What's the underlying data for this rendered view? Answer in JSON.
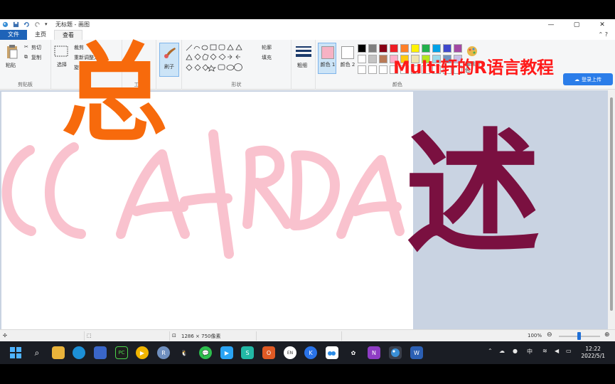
{
  "window": {
    "title": "无标题 - 画图",
    "controls": {
      "minimize": "—",
      "maximize": "▢",
      "close": "✕"
    }
  },
  "tabs": [
    {
      "label": "文件"
    },
    {
      "label": "主页"
    },
    {
      "label": "查看"
    }
  ],
  "ribbon": {
    "clipboard": {
      "paste": "粘贴",
      "cut": "剪切",
      "copy": "复制",
      "group_label": "剪贴板"
    },
    "image": {
      "select": "选择",
      "crop": "裁剪",
      "resize": "重新调整大小",
      "rotate": "旋转"
    },
    "tools": {
      "group_label": "工具"
    },
    "brush": {
      "label": "刷子"
    },
    "shapes": {
      "outline": "轮廓",
      "fill": "填充",
      "group_label": "形状"
    },
    "size": {
      "label": "粗细"
    },
    "color1": {
      "label": "颜色 1",
      "value": "#f7b2c4"
    },
    "color2": {
      "label": "颜色 2",
      "value": "#ffffff"
    },
    "colors": {
      "group_label": "颜色",
      "edit": "编辑颜色"
    },
    "palette": [
      "#000000",
      "#7f7f7f",
      "#880015",
      "#ed1c24",
      "#ff7f27",
      "#fff200",
      "#22b14c",
      "#00a2e8",
      "#3f48cc",
      "#a349a4",
      "#ffffff",
      "#c3c3c3",
      "#b97a57",
      "#ffaec9",
      "#ffc90e",
      "#efe4b0",
      "#b5e61d",
      "#99d9ea",
      "#7092be",
      "#c8bfe7",
      "#ffffff",
      "#ffffff",
      "#ffffff",
      "#ffffff",
      "#ffffff",
      "#ffffff",
      "#ffffff",
      "#ffffff",
      "#ffffff",
      "#ffffff"
    ],
    "sign_in": "登录上传"
  },
  "status": {
    "canvas_size": "1286 × 750像素",
    "zoom": "100%"
  },
  "taskbar": {
    "ime": "中",
    "lang": "EN",
    "time": "12:22",
    "date": "2022/5/1"
  },
  "overlay": {
    "channel_title": "Multi轩的R语言教程",
    "word_left": "总",
    "word_right": "述",
    "handwriting": "CCAtRDA",
    "handwriting_color": "#f9b8c6"
  }
}
